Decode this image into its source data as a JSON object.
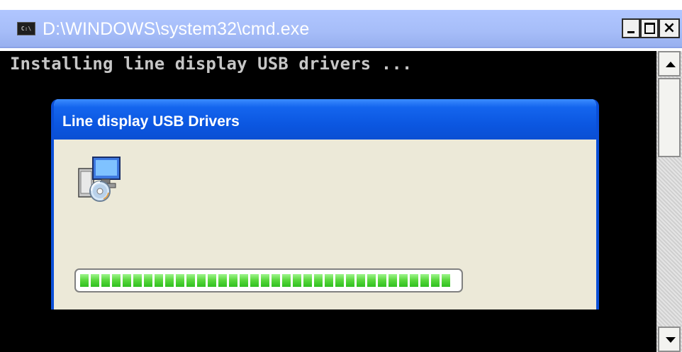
{
  "window": {
    "title": "D:\\WINDOWS\\system32\\cmd.exe",
    "app_icon_text": "C:\\",
    "controls": {
      "minimize": "_",
      "maximize": "□",
      "close": "×"
    }
  },
  "console": {
    "lines": [
      "Installing line display USB drivers ..."
    ]
  },
  "dialog": {
    "title": "Line display USB Drivers",
    "icon": "installer-cd-computer-icon",
    "progress_percent": 100
  },
  "colors": {
    "console_background": "#000000",
    "console_text": "#c6c6c6",
    "dialog_title_blue": "#0b56e0",
    "dialog_body": "#ece9d8",
    "progress_green": "#39c92a"
  }
}
